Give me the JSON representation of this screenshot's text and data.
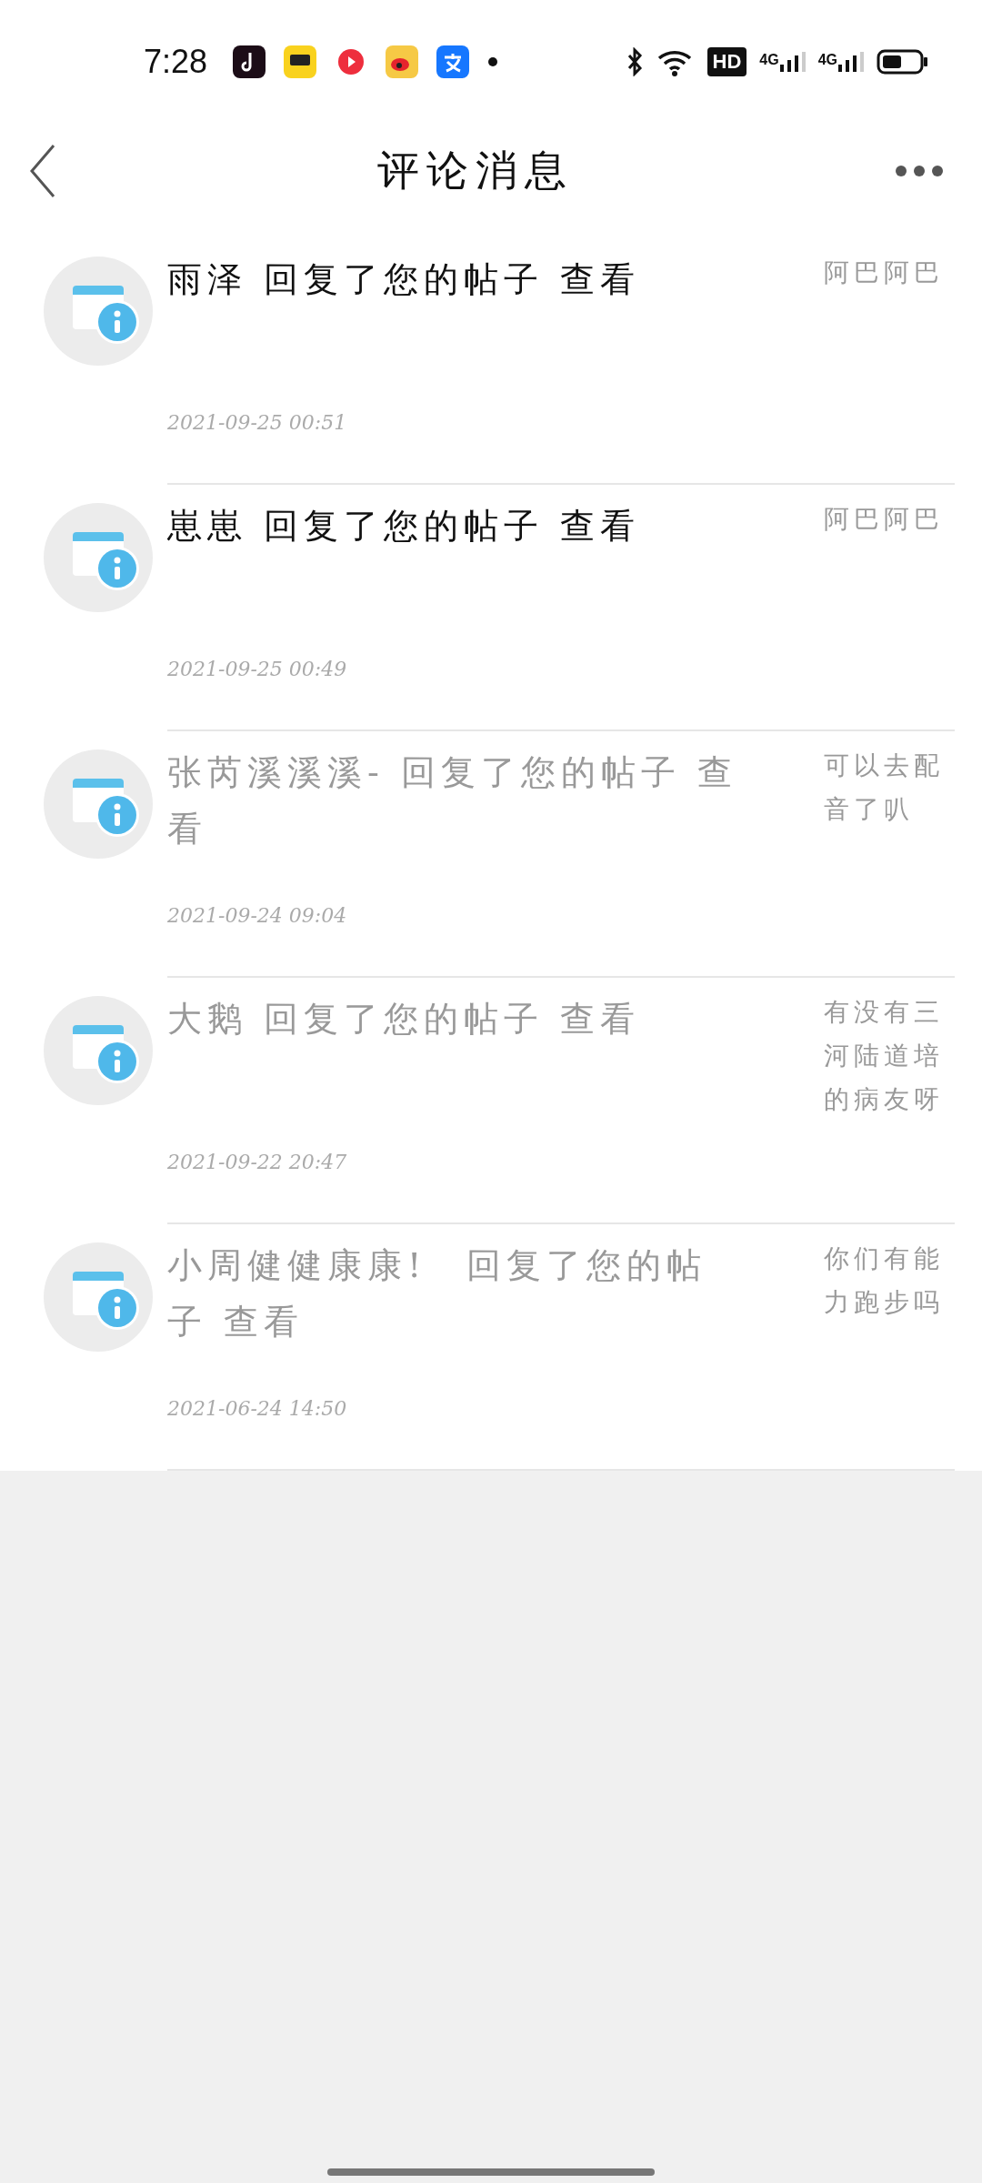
{
  "status_bar": {
    "time": "7:28",
    "network": [
      "4G",
      "4G"
    ],
    "hd": "HD"
  },
  "header": {
    "title": "评论消息"
  },
  "messages": [
    {
      "text": "雨泽 回复了您的帖子 查看",
      "time": "2021-09-25 00:51",
      "comment": "阿巴阿巴",
      "unread": true
    },
    {
      "text": "崽崽 回复了您的帖子 查看",
      "time": "2021-09-25 00:49",
      "comment": "阿巴阿巴",
      "unread": true
    },
    {
      "text": "张芮溪溪溪- 回复了您的帖子 查看",
      "time": "2021-09-24 09:04",
      "comment": "可以去配音了叭",
      "unread": false
    },
    {
      "text": "大鹅 回复了您的帖子 查看",
      "time": "2021-09-22 20:47",
      "comment": "有没有三河陆道培的病友呀",
      "unread": false
    },
    {
      "text": "小周健健康康!　回复了您的帖子 查看",
      "time": "2021-06-24 14:50",
      "comment": "你们有能力跑步吗",
      "unread": false
    }
  ]
}
